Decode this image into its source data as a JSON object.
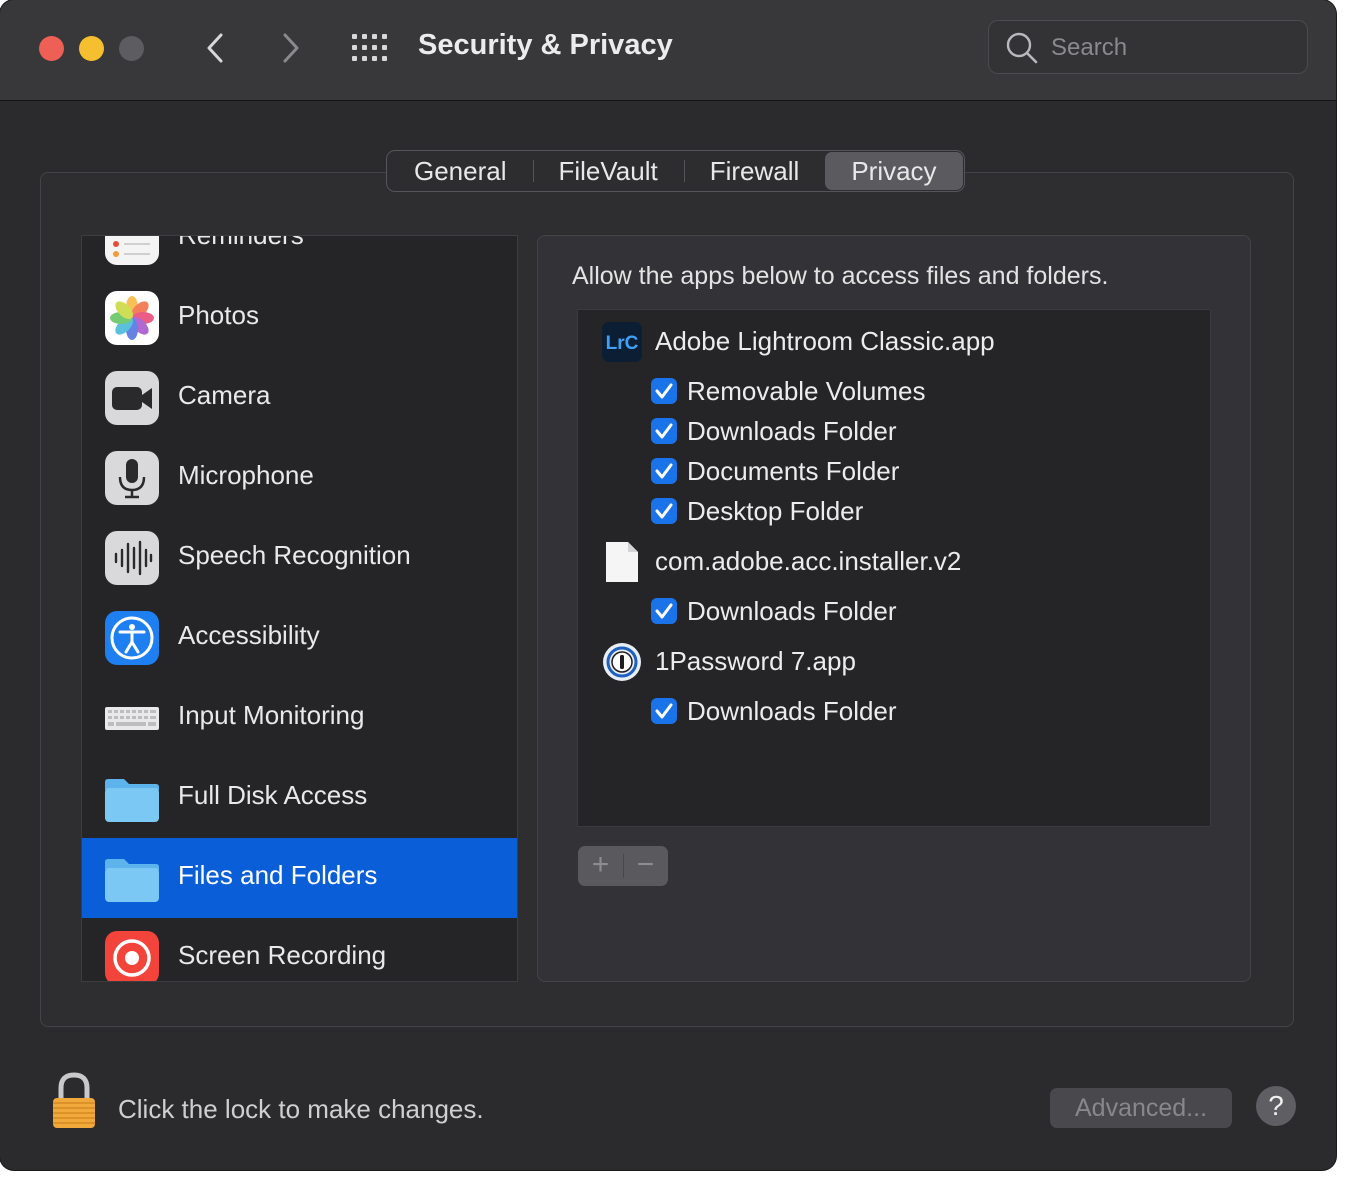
{
  "window": {
    "title": "Security & Privacy",
    "search": {
      "placeholder": "Search",
      "value": ""
    }
  },
  "tabs": [
    {
      "label": "General",
      "active": false
    },
    {
      "label": "FileVault",
      "active": false
    },
    {
      "label": "Firewall",
      "active": false
    },
    {
      "label": "Privacy",
      "active": true
    }
  ],
  "sidebar": {
    "items": [
      {
        "label": "Reminders",
        "icon": "reminders-icon"
      },
      {
        "label": "Photos",
        "icon": "photos-icon"
      },
      {
        "label": "Camera",
        "icon": "camera-icon"
      },
      {
        "label": "Microphone",
        "icon": "microphone-icon"
      },
      {
        "label": "Speech Recognition",
        "icon": "speech-recognition-icon"
      },
      {
        "label": "Accessibility",
        "icon": "accessibility-icon"
      },
      {
        "label": "Input Monitoring",
        "icon": "keyboard-icon"
      },
      {
        "label": "Full Disk Access",
        "icon": "folder-icon"
      },
      {
        "label": "Files and Folders",
        "icon": "folder-icon",
        "selected": true
      },
      {
        "label": "Screen Recording",
        "icon": "screen-recording-icon"
      }
    ]
  },
  "panel": {
    "description": "Allow the apps below to access files and folders.",
    "apps": [
      {
        "name": "Adobe Lightroom Classic.app",
        "icon": "lightroom-icon",
        "icon_text": "LrC",
        "permissions": [
          {
            "label": "Removable Volumes",
            "checked": true
          },
          {
            "label": "Downloads Folder",
            "checked": true
          },
          {
            "label": "Documents Folder",
            "checked": true
          },
          {
            "label": "Desktop Folder",
            "checked": true
          }
        ]
      },
      {
        "name": "com.adobe.acc.installer.v2",
        "icon": "document-icon",
        "permissions": [
          {
            "label": "Downloads Folder",
            "checked": true
          }
        ]
      },
      {
        "name": "1Password 7.app",
        "icon": "onepassword-icon",
        "permissions": [
          {
            "label": "Downloads Folder",
            "checked": true
          }
        ]
      }
    ],
    "add_label": "+",
    "remove_label": "−"
  },
  "footer": {
    "lock_text": "Click the lock to make changes.",
    "advanced_label": "Advanced...",
    "help_label": "?"
  },
  "colors": {
    "accent": "#0a5ed7",
    "checkbox": "#1a73e8",
    "close": "#ee5f56",
    "minimize": "#f5bf2f"
  }
}
